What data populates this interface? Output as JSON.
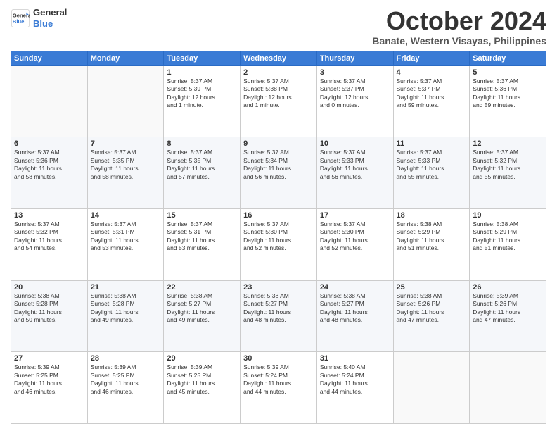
{
  "logo": {
    "line1": "General",
    "line2": "Blue"
  },
  "title": "October 2024",
  "subtitle": "Banate, Western Visayas, Philippines",
  "days_of_week": [
    "Sunday",
    "Monday",
    "Tuesday",
    "Wednesday",
    "Thursday",
    "Friday",
    "Saturday"
  ],
  "weeks": [
    [
      {
        "day": "",
        "info": ""
      },
      {
        "day": "",
        "info": ""
      },
      {
        "day": "1",
        "info": "Sunrise: 5:37 AM\nSunset: 5:39 PM\nDaylight: 12 hours\nand 1 minute."
      },
      {
        "day": "2",
        "info": "Sunrise: 5:37 AM\nSunset: 5:38 PM\nDaylight: 12 hours\nand 1 minute."
      },
      {
        "day": "3",
        "info": "Sunrise: 5:37 AM\nSunset: 5:37 PM\nDaylight: 12 hours\nand 0 minutes."
      },
      {
        "day": "4",
        "info": "Sunrise: 5:37 AM\nSunset: 5:37 PM\nDaylight: 11 hours\nand 59 minutes."
      },
      {
        "day": "5",
        "info": "Sunrise: 5:37 AM\nSunset: 5:36 PM\nDaylight: 11 hours\nand 59 minutes."
      }
    ],
    [
      {
        "day": "6",
        "info": "Sunrise: 5:37 AM\nSunset: 5:36 PM\nDaylight: 11 hours\nand 58 minutes."
      },
      {
        "day": "7",
        "info": "Sunrise: 5:37 AM\nSunset: 5:35 PM\nDaylight: 11 hours\nand 58 minutes."
      },
      {
        "day": "8",
        "info": "Sunrise: 5:37 AM\nSunset: 5:35 PM\nDaylight: 11 hours\nand 57 minutes."
      },
      {
        "day": "9",
        "info": "Sunrise: 5:37 AM\nSunset: 5:34 PM\nDaylight: 11 hours\nand 56 minutes."
      },
      {
        "day": "10",
        "info": "Sunrise: 5:37 AM\nSunset: 5:33 PM\nDaylight: 11 hours\nand 56 minutes."
      },
      {
        "day": "11",
        "info": "Sunrise: 5:37 AM\nSunset: 5:33 PM\nDaylight: 11 hours\nand 55 minutes."
      },
      {
        "day": "12",
        "info": "Sunrise: 5:37 AM\nSunset: 5:32 PM\nDaylight: 11 hours\nand 55 minutes."
      }
    ],
    [
      {
        "day": "13",
        "info": "Sunrise: 5:37 AM\nSunset: 5:32 PM\nDaylight: 11 hours\nand 54 minutes."
      },
      {
        "day": "14",
        "info": "Sunrise: 5:37 AM\nSunset: 5:31 PM\nDaylight: 11 hours\nand 53 minutes."
      },
      {
        "day": "15",
        "info": "Sunrise: 5:37 AM\nSunset: 5:31 PM\nDaylight: 11 hours\nand 53 minutes."
      },
      {
        "day": "16",
        "info": "Sunrise: 5:37 AM\nSunset: 5:30 PM\nDaylight: 11 hours\nand 52 minutes."
      },
      {
        "day": "17",
        "info": "Sunrise: 5:37 AM\nSunset: 5:30 PM\nDaylight: 11 hours\nand 52 minutes."
      },
      {
        "day": "18",
        "info": "Sunrise: 5:38 AM\nSunset: 5:29 PM\nDaylight: 11 hours\nand 51 minutes."
      },
      {
        "day": "19",
        "info": "Sunrise: 5:38 AM\nSunset: 5:29 PM\nDaylight: 11 hours\nand 51 minutes."
      }
    ],
    [
      {
        "day": "20",
        "info": "Sunrise: 5:38 AM\nSunset: 5:28 PM\nDaylight: 11 hours\nand 50 minutes."
      },
      {
        "day": "21",
        "info": "Sunrise: 5:38 AM\nSunset: 5:28 PM\nDaylight: 11 hours\nand 49 minutes."
      },
      {
        "day": "22",
        "info": "Sunrise: 5:38 AM\nSunset: 5:27 PM\nDaylight: 11 hours\nand 49 minutes."
      },
      {
        "day": "23",
        "info": "Sunrise: 5:38 AM\nSunset: 5:27 PM\nDaylight: 11 hours\nand 48 minutes."
      },
      {
        "day": "24",
        "info": "Sunrise: 5:38 AM\nSunset: 5:27 PM\nDaylight: 11 hours\nand 48 minutes."
      },
      {
        "day": "25",
        "info": "Sunrise: 5:38 AM\nSunset: 5:26 PM\nDaylight: 11 hours\nand 47 minutes."
      },
      {
        "day": "26",
        "info": "Sunrise: 5:39 AM\nSunset: 5:26 PM\nDaylight: 11 hours\nand 47 minutes."
      }
    ],
    [
      {
        "day": "27",
        "info": "Sunrise: 5:39 AM\nSunset: 5:25 PM\nDaylight: 11 hours\nand 46 minutes."
      },
      {
        "day": "28",
        "info": "Sunrise: 5:39 AM\nSunset: 5:25 PM\nDaylight: 11 hours\nand 46 minutes."
      },
      {
        "day": "29",
        "info": "Sunrise: 5:39 AM\nSunset: 5:25 PM\nDaylight: 11 hours\nand 45 minutes."
      },
      {
        "day": "30",
        "info": "Sunrise: 5:39 AM\nSunset: 5:24 PM\nDaylight: 11 hours\nand 44 minutes."
      },
      {
        "day": "31",
        "info": "Sunrise: 5:40 AM\nSunset: 5:24 PM\nDaylight: 11 hours\nand 44 minutes."
      },
      {
        "day": "",
        "info": ""
      },
      {
        "day": "",
        "info": ""
      }
    ]
  ]
}
